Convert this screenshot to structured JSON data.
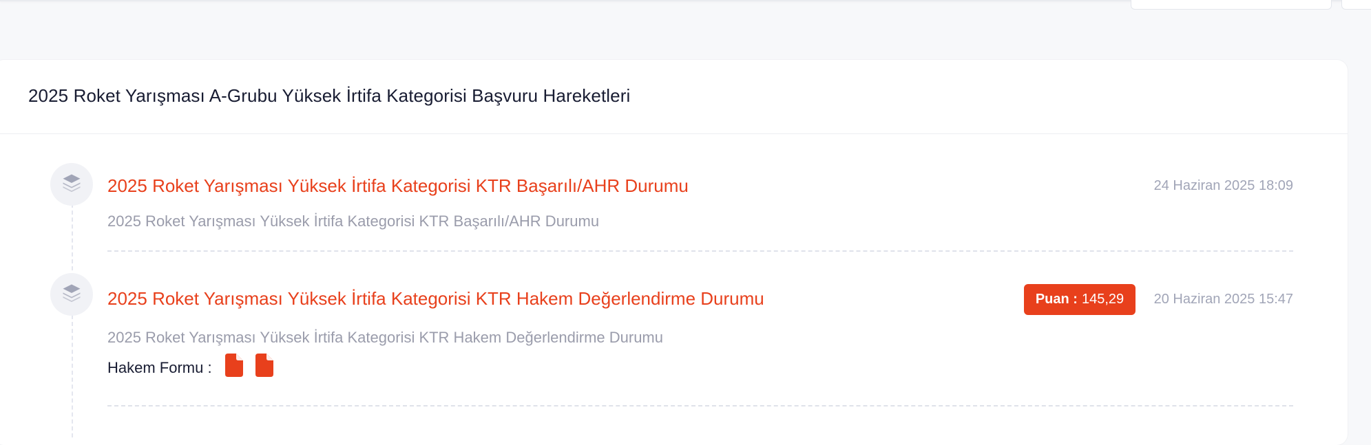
{
  "card": {
    "title": "2025 Roket Yarışması A-Grubu Yüksek İrtifa Kategorisi Başvuru Hareketleri"
  },
  "timeline": [
    {
      "icon": "layers-icon",
      "title": "2025 Roket Yarışması Yüksek İrtifa Kategorisi KTR Başarılı/AHR Durumu",
      "description": "2025 Roket Yarışması Yüksek İrtifa Kategorisi KTR Başarılı/AHR Durumu",
      "date": "24 Haziran 2025 18:09"
    },
    {
      "icon": "layers-icon",
      "title": "2025 Roket Yarışması Yüksek İrtifa Kategorisi KTR Hakem Değerlendirme Durumu",
      "description": "2025 Roket Yarışması Yüksek İrtifa Kategorisi KTR Hakem Değerlendirme Durumu",
      "date": "20 Haziran 2025 15:47",
      "score": {
        "label": "Puan :",
        "value": "145,29"
      },
      "form": {
        "label": "Hakem Formu :",
        "files": [
          "file-icon",
          "file-icon"
        ]
      }
    }
  ],
  "colors": {
    "accent": "#e8401c",
    "title_text": "#181c32",
    "muted_text": "#9a9cab",
    "icon_bg": "#f1f2f6",
    "icon_fg": "#a1a5b7"
  }
}
